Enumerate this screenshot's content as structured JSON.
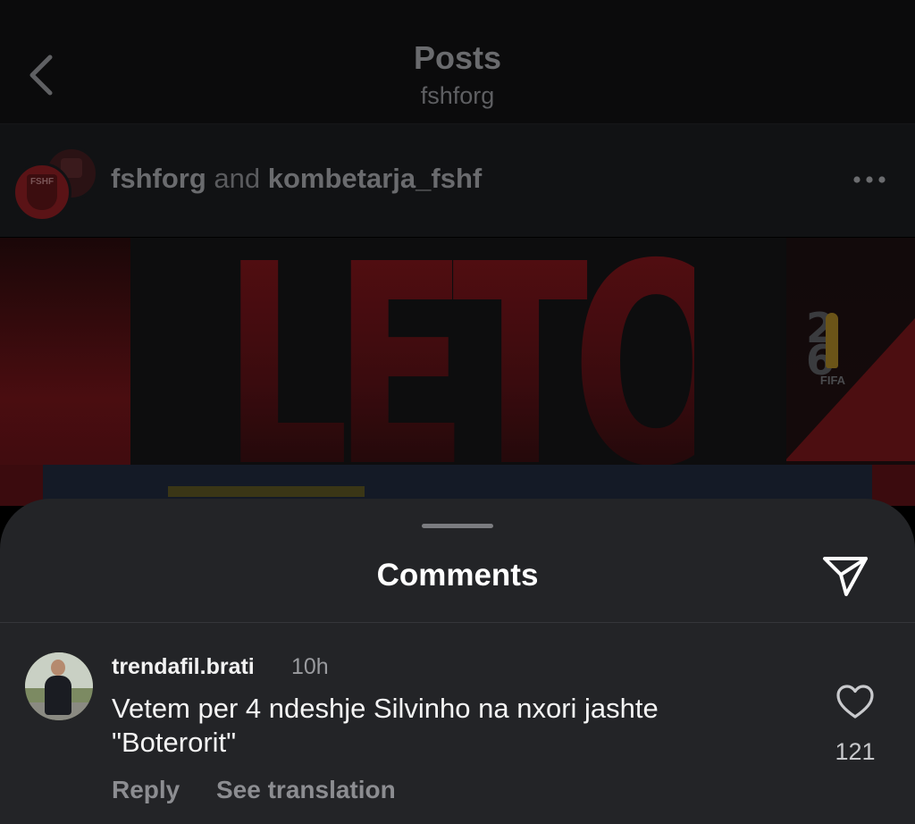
{
  "header": {
    "title": "Posts",
    "subtitle": "fshforg",
    "back_icon": "chevron-left-icon"
  },
  "post": {
    "author_primary": "fshforg",
    "author_joiner": "and",
    "author_secondary": "kombetarja_fshf",
    "avatar_badge_text": "FSHF",
    "more_icon": "ellipsis-icon",
    "banner_word": "LETONI",
    "logo_numbers": [
      "2",
      "6"
    ],
    "logo_text": "FIFA"
  },
  "comments_sheet": {
    "title": "Comments",
    "share_icon": "send-icon",
    "comments": [
      {
        "username": "trendafil.brati",
        "time": "10h",
        "text_line1": "Vetem per 4 ndeshje Silvinho na nxori jashte",
        "text_line2": "\"Boterorit\"",
        "like_icon": "heart-outline-icon",
        "like_count": "121",
        "reply_label": "Reply",
        "translate_label": "See translation"
      }
    ]
  },
  "colors": {
    "sheet_background": "#232427",
    "page_background": "#000000",
    "accent_red": "#5a0e12"
  }
}
